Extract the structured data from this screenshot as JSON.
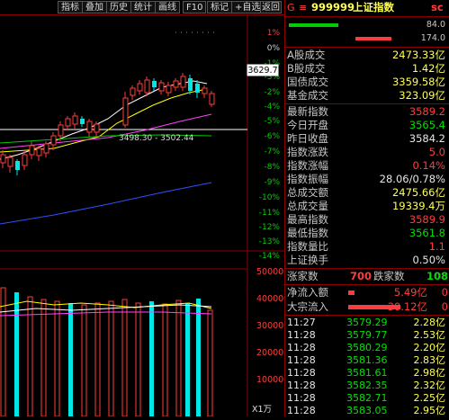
{
  "toolbar": {
    "items": [
      "指标",
      "叠加",
      "历史",
      "统计",
      "画线",
      "F10",
      "标记",
      "+自选",
      "返回"
    ]
  },
  "chart": {
    "right_axis_labels": [
      "1%",
      "0%",
      "-1%",
      "-2%",
      "-3%",
      "-4%",
      "-5%",
      "-6%",
      "-7%",
      "-8%",
      "-9%",
      "-10%",
      "-11%",
      "-12%",
      "-13%",
      "-14%"
    ],
    "current_price_tag": "3629.7",
    "range_annotation": "3498.30 - 3502.44",
    "volume_axis_labels": [
      "50000",
      "40000",
      "30000",
      "20000",
      "10000",
      "X1万"
    ],
    "colors": {
      "up": "#ff3c3c",
      "down": "#00e6e6",
      "ma1": "#ffffff",
      "ma2": "#ffff00",
      "ma3": "#ff40ff",
      "ma4": "#00cc00",
      "ma5": "#3050ff",
      "grid": "#8a0000"
    }
  },
  "panel": {
    "header": {
      "code_icon": "G",
      "code": "999999",
      "name": "上证指数",
      "suffix": "sc"
    },
    "ratio_values": [
      "84.0",
      "174.0"
    ],
    "stats": [
      {
        "label": "A股成交",
        "value": "2473.33亿",
        "color": "#ffff55"
      },
      {
        "label": "B股成交",
        "value": "1.42亿",
        "color": "#ffff55"
      },
      {
        "label": "国债成交",
        "value": "3359.58亿",
        "color": "#ffff55"
      },
      {
        "label": "基金成交",
        "value": "323.09亿",
        "color": "#ffff55"
      }
    ],
    "quote": [
      {
        "label": "最新指数",
        "value": "3589.2",
        "color": "#ff3c3c"
      },
      {
        "label": "今日开盘",
        "value": "3565.4",
        "color": "#00e000"
      },
      {
        "label": "昨日收盘",
        "value": "3584.2",
        "color": "#e6e6e6"
      },
      {
        "label": "指数涨跌",
        "value": "5.0",
        "color": "#ff3c3c"
      },
      {
        "label": "指数涨幅",
        "value": "0.14%",
        "color": "#ff3c3c"
      },
      {
        "label": "指数振幅",
        "value": "28.06/0.78%",
        "color": "#e6e6e6"
      },
      {
        "label": "总成交额",
        "value": "2475.66亿",
        "color": "#ffff55"
      },
      {
        "label": "总成交量",
        "value": "19339.4万",
        "color": "#ffff55"
      },
      {
        "label": "最高指数",
        "value": "3589.9",
        "color": "#ff3c3c"
      },
      {
        "label": "最低指数",
        "value": "3561.8",
        "color": "#00e000"
      },
      {
        "label": "指数量比",
        "value": "1.1",
        "color": "#ff3c3c"
      },
      {
        "label": "上证换手",
        "value": "0.50%",
        "color": "#e6e6e6"
      }
    ],
    "breadth": {
      "up_label": "涨家数",
      "up_value": "700",
      "down_label": "跌家数",
      "down_value": "108"
    },
    "flows": [
      {
        "label": "净流入额",
        "value": "5.49亿",
        "extra": "0"
      },
      {
        "label": "大宗流入",
        "value": "30.12亿",
        "extra": "0"
      }
    ],
    "ticks": [
      {
        "time": "11:27",
        "price": "3579.29",
        "vol": "2.28亿"
      },
      {
        "time": "11:28",
        "price": "3579.77",
        "vol": "2.53亿"
      },
      {
        "time": "11:28",
        "price": "3580.29",
        "vol": "2.20亿"
      },
      {
        "time": "11:28",
        "price": "3581.36",
        "vol": "2.83亿"
      },
      {
        "time": "11:28",
        "price": "3581.61",
        "vol": "2.98亿"
      },
      {
        "time": "11:28",
        "price": "3582.35",
        "vol": "2.32亿"
      },
      {
        "time": "11:28",
        "price": "3582.71",
        "vol": "2.25亿"
      },
      {
        "time": "11:28",
        "price": "3583.05",
        "vol": "2.95亿"
      }
    ]
  }
}
